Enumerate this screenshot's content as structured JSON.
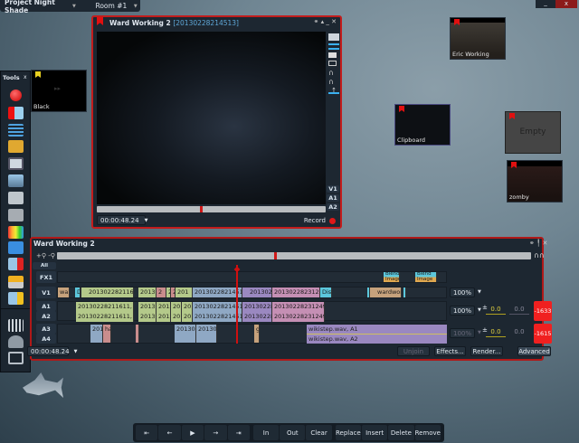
{
  "topbar": {
    "project": "Project Night Shade",
    "room": "Room #1"
  },
  "window_controls": {
    "minimize": "_",
    "close": "x"
  },
  "viewer": {
    "title": "Ward Working 2",
    "id": "[20130228214513]",
    "timecode": "00:00:48.24",
    "tracks": [
      "V1",
      "A1",
      "A2"
    ],
    "record_label": "Record"
  },
  "tools": {
    "title": "Tools",
    "close": "x",
    "icons": [
      "record-icon",
      "import-icon",
      "edit-icon",
      "search-bin-icon",
      "viewer-icon",
      "rack-icon",
      "export-icon",
      "device-icon",
      "color-icon",
      "calculator-icon",
      "cut-icon",
      "sync-icon",
      "output-icon",
      "grid-icon",
      "users-icon",
      "download-icon"
    ]
  },
  "tiles": {
    "black": "Black",
    "eric": "Eric Working",
    "clipboard": "Clipboard",
    "empty": "Empty",
    "zomby": "zomby"
  },
  "timeline": {
    "title": "Ward Working 2",
    "all": "All",
    "tracks": {
      "fx1": "FX1",
      "v1": "V1",
      "a1": "A1",
      "a2": "A2",
      "a3": "A3",
      "a4": "A4"
    },
    "fx": [
      "Blend Image",
      "Blend Image"
    ],
    "v1": [
      "wa",
      "D",
      "20130228211611",
      "20130",
      "2",
      "2",
      "2",
      "201",
      "20130228214513",
      "20130228",
      "20130228231249",
      "Dis",
      "wardwor"
    ],
    "a1": [
      "20130228211611, A1",
      "20130",
      "2013",
      "20",
      "20",
      "20130228214513, A1",
      "20130228",
      "20130228231249, A1"
    ],
    "a2": [
      "20130228211611, A2",
      "20130",
      "2013",
      "20",
      "20",
      "20130228214513, A2",
      "20130228",
      "20130228231249, A2"
    ],
    "a34": [
      "201",
      "ha",
      "20130",
      "201302",
      "g",
      "wikistep.wav, A1",
      "wikistep.wav, A2"
    ],
    "v1_level": "100%",
    "a12_level": "100%",
    "a34_level": "100%",
    "a12_gain": "0.0",
    "a12_pan": "0.0",
    "a12_meter": "-1633",
    "a34_gain": "0.0",
    "a34_pan": "0.0",
    "a34_meter": "-1615",
    "timecode": "00:00:48.24",
    "buttons": {
      "unjoin": "Unjoin",
      "effects": "Effects...",
      "render": "Render...",
      "advanced": "Advanced"
    }
  },
  "transport": {
    "start": "⇤",
    "back": "←",
    "play": "▶",
    "fwd": "→",
    "end": "⇥",
    "in": "In",
    "out": "Out",
    "clear": "Clear",
    "replace": "Replace",
    "insert": "Insert",
    "delete": "Delete",
    "remove": "Remove"
  },
  "colors": {
    "accent": "#c31c1c",
    "meter": "#f02020"
  }
}
